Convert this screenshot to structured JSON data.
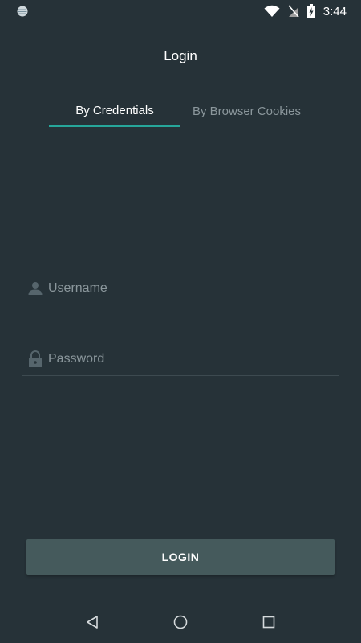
{
  "status_bar": {
    "time": "3:44",
    "icons": [
      "notification-dot-icon",
      "wifi-icon",
      "no-sim-icon",
      "battery-charging-icon"
    ]
  },
  "header": {
    "title": "Login"
  },
  "tabs": [
    {
      "label": "By Credentials",
      "selected": true
    },
    {
      "label": "By Browser Cookies",
      "selected": false
    }
  ],
  "form": {
    "username": {
      "placeholder": "Username",
      "value": "",
      "icon": "person-icon"
    },
    "password": {
      "placeholder": "Password",
      "value": "",
      "icon": "lock-icon"
    },
    "login_label": "LOGIN"
  },
  "nav_bar": {
    "icons": [
      "back-icon",
      "home-icon",
      "recents-icon"
    ]
  },
  "colors": {
    "background": "#263238",
    "accent": "#26a69a",
    "button": "#455a5c",
    "muted_text": "#8b979c"
  }
}
